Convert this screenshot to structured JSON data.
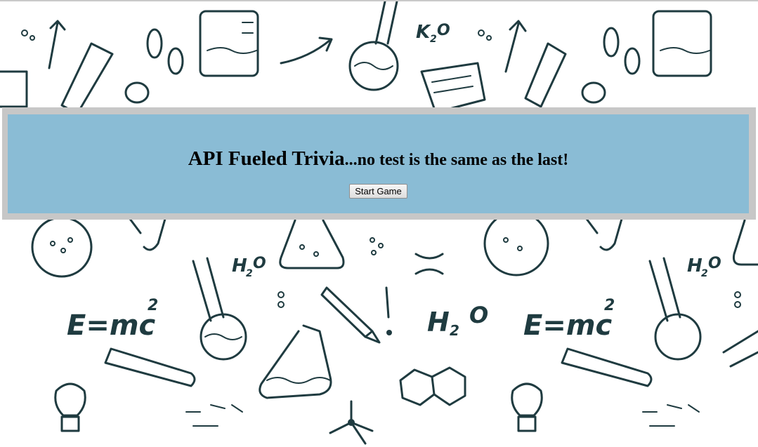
{
  "header": {
    "title": "API Fueled Trivia",
    "tagline": "...no test is the same as the last!"
  },
  "actions": {
    "start_label": "Start Game"
  },
  "background": {
    "doodle_labels": {
      "formula_1": "K",
      "formula_1_sub": "2",
      "formula_1_end": "O",
      "water": "H",
      "water_sub": "2",
      "water_end": "O",
      "energy": "E=mc",
      "energy_exp": "2"
    }
  },
  "colors": {
    "panel": "#8abcd5",
    "frame": "#c7c7c7",
    "ink": "#1f3b40"
  }
}
